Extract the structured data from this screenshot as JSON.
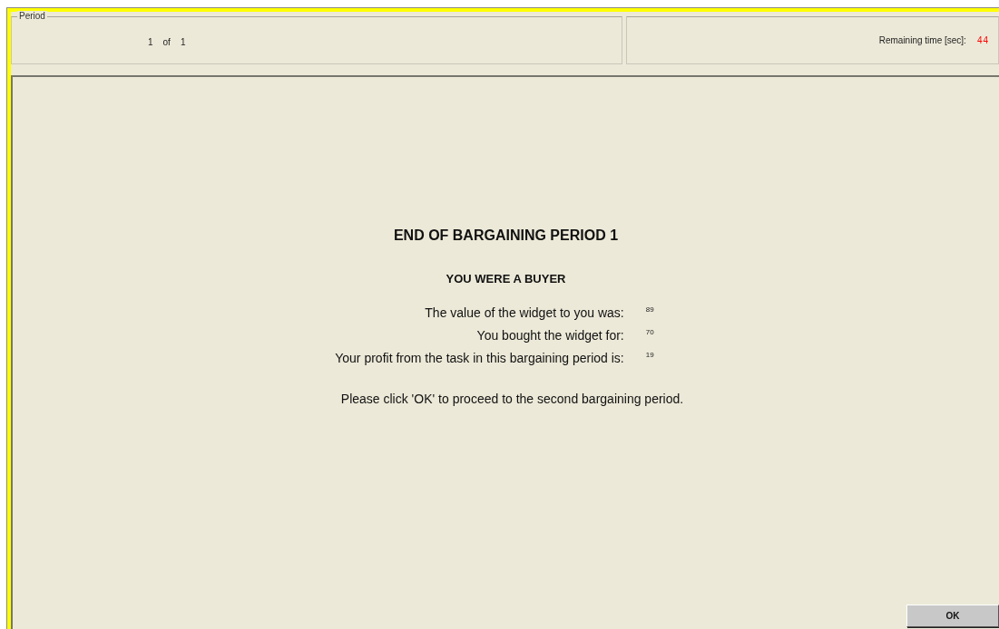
{
  "period_panel": {
    "title": "Period",
    "current": "1",
    "of_label": "of",
    "total": "1"
  },
  "timer_panel": {
    "label": "Remaining time [sec]:",
    "value": "44"
  },
  "main": {
    "heading": "END OF BARGAINING PERIOD 1",
    "role": "YOU WERE A BUYER",
    "rows": [
      {
        "label": "The value of the widget to you was:",
        "value": "89"
      },
      {
        "label": "You bought the widget for:",
        "value": "70"
      },
      {
        "label": "Your profit from the task in this bargaining period is:",
        "value": "19"
      }
    ],
    "instruction": "Please click 'OK' to proceed to the second bargaining period."
  },
  "buttons": [
    "OK"
  ]
}
